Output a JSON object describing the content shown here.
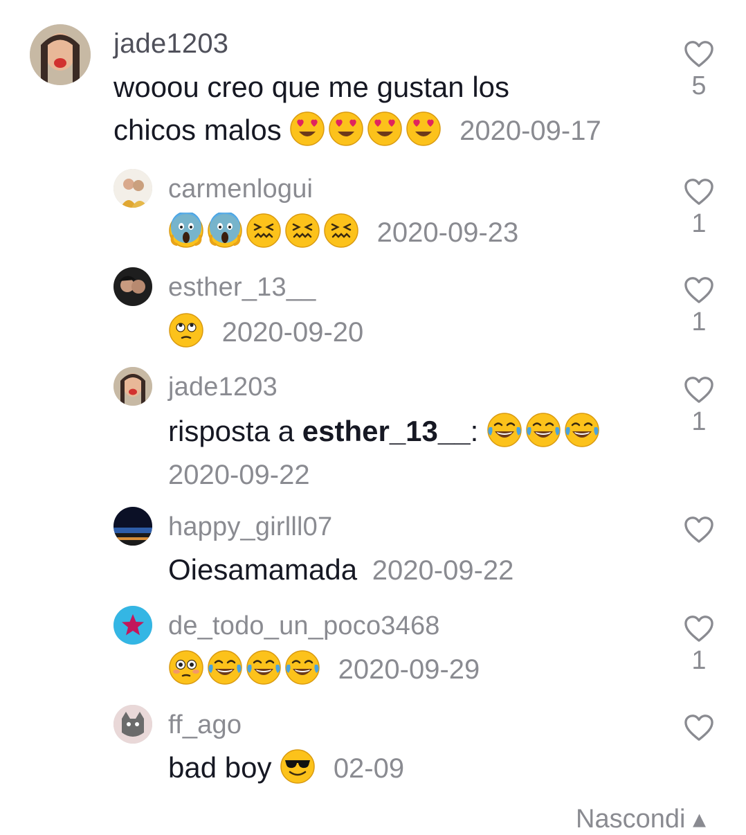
{
  "comments": [
    {
      "username": "jade1203",
      "text_line1": "wooou creo que me gustan los",
      "text_line2": "chicos malos",
      "emojis": [
        "heart-eyes",
        "heart-eyes",
        "heart-eyes",
        "heart-eyes"
      ],
      "date": "2020-09-17",
      "likes": "5"
    }
  ],
  "replies": [
    {
      "username": "carmenlogui",
      "text": "",
      "emojis": [
        "scream",
        "scream",
        "confounded",
        "confounded",
        "confounded"
      ],
      "date": "2020-09-23",
      "likes": "1"
    },
    {
      "username": "esther_13__",
      "text": "",
      "emojis": [
        "rolling-eyes"
      ],
      "date": "2020-09-20",
      "likes": "1"
    },
    {
      "username": "jade1203",
      "reply_prefix": "risposta a ",
      "reply_to": "esther_13__",
      "reply_suffix": ":",
      "emojis": [
        "joy",
        "joy",
        "joy"
      ],
      "date": "2020-09-22",
      "likes": "1"
    },
    {
      "username": "happy_girlll07",
      "text": "Oiesamamada",
      "emojis": [],
      "date": "2020-09-22",
      "likes": ""
    },
    {
      "username": "de_todo_un_poco3468",
      "text": "",
      "emojis": [
        "flushed",
        "joy",
        "joy",
        "joy"
      ],
      "date": "2020-09-29",
      "likes": "1"
    },
    {
      "username": "ff_ago",
      "text": "bad boy",
      "emojis": [
        "sunglasses"
      ],
      "date": "02-09",
      "likes": ""
    }
  ],
  "hide_replies_label": "Nascondi",
  "colors": {
    "text": "#161823",
    "muted": "#8a8b91",
    "emoji_yellow": "#fcc21b"
  }
}
